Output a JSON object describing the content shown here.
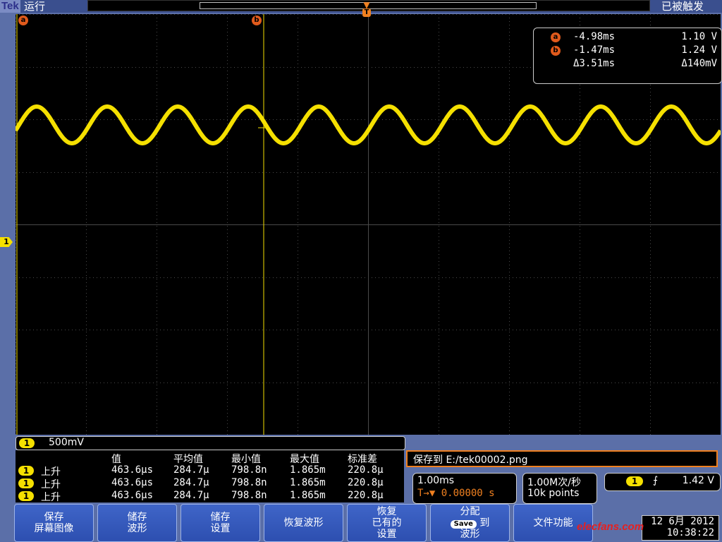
{
  "header": {
    "brand": "Tek",
    "run_state": "运行",
    "trigger_state": "已被触发"
  },
  "cursors": {
    "a_label": "a",
    "b_label": "b",
    "trigger_label": "T"
  },
  "cursor_readout": {
    "a": {
      "label": "a",
      "time": "-4.98ms",
      "voltage": "1.10 V"
    },
    "b": {
      "label": "b",
      "time": "-1.47ms",
      "voltage": "1.24 V"
    },
    "delta": {
      "time": "Δ3.51ms",
      "voltage": "Δ140mV"
    }
  },
  "channel": {
    "number": "1",
    "scale": "500mV",
    "color": "#f5e000"
  },
  "measurements": {
    "headers": [
      "值",
      "平均值",
      "最小值",
      "最大值",
      "标准差"
    ],
    "rows": [
      {
        "ch": "1",
        "type": "上升",
        "value": "463.6µs",
        "mean": "284.7µ",
        "min": "798.8n",
        "max": "1.865m",
        "std": "220.8µ"
      },
      {
        "ch": "1",
        "type": "上升",
        "value": "463.6µs",
        "mean": "284.7µ",
        "min": "798.8n",
        "max": "1.865m",
        "std": "220.8µ"
      },
      {
        "ch": "1",
        "type": "上升",
        "value": "463.6µs",
        "mean": "284.7µ",
        "min": "798.8n",
        "max": "1.865m",
        "std": "220.8µ"
      }
    ]
  },
  "save_message": "保存到 E:/tek00002.png",
  "horizontal": {
    "scale": "1.00ms",
    "position": "0.00000 s"
  },
  "acquisition": {
    "rate": "1.00M次/秒",
    "points": "10k points"
  },
  "trigger": {
    "channel": "1",
    "slope_symbol": "⨍",
    "level": "1.42 V"
  },
  "softkeys": [
    {
      "line1": "保存",
      "line2": "屏幕图像",
      "line3": ""
    },
    {
      "line1": "储存",
      "line2": "波形",
      "line3": ""
    },
    {
      "line1": "储存",
      "line2": "设置",
      "line3": ""
    },
    {
      "line1": "恢复波形",
      "line2": "",
      "line3": ""
    },
    {
      "line1": "恢复",
      "line2": "已有的",
      "line3": "设置"
    },
    {
      "line1": "分配",
      "line2": "到",
      "line3": "波形",
      "chip": "Save"
    },
    {
      "line1": "文件功能",
      "line2": "",
      "line3": ""
    }
  ],
  "datetime": {
    "date": "12 6月 2012",
    "time": "10:38:22"
  },
  "watermark": "elecfans.com",
  "colors": {
    "trace": "#f5e000",
    "cursor_badge": "#e05a1c",
    "softkey": "#3a5fc4",
    "frame": "#5b6fa8"
  }
}
